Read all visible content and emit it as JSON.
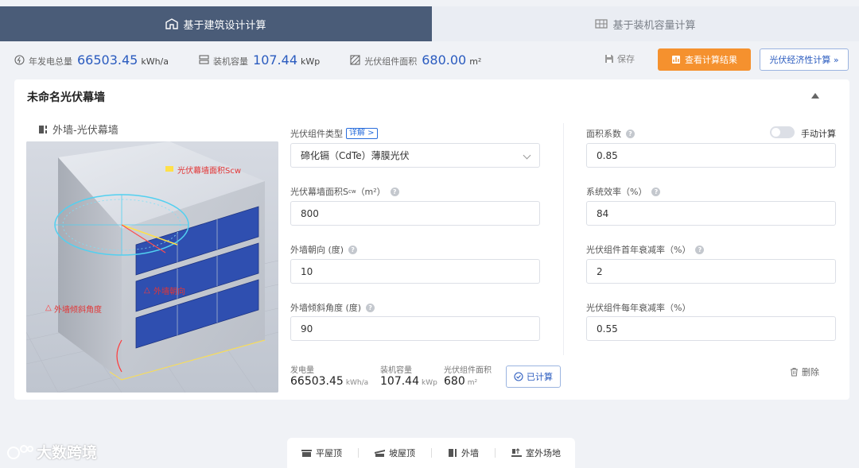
{
  "tabs": [
    {
      "label": "基于建筑设计计算",
      "icon": "building-icon",
      "active": true
    },
    {
      "label": "基于装机容量计算",
      "icon": "panel-grid-icon",
      "active": false
    }
  ],
  "summary": {
    "annual_generation": {
      "label": "年发电总量",
      "value": "66503.45",
      "unit": "kWh/a"
    },
    "capacity": {
      "label": "装机容量",
      "value": "107.44",
      "unit": "kWp"
    },
    "area": {
      "label": "光伏组件面积",
      "value": "680.00",
      "unit": "m²"
    }
  },
  "actions": {
    "save_label": "保存",
    "view_result_label": "查看计算结果",
    "economics_label": "光伏经济性计算 »"
  },
  "card": {
    "title": "未命名光伏幕墙",
    "section_label": "外墙-光伏幕墙",
    "illustration": {
      "area_label": "光伏幕墙面积Scw",
      "orientation_label": "外墙朝向",
      "tilt_label": "外墙倾斜角度"
    }
  },
  "form": {
    "module_type": {
      "label": "光伏组件类型",
      "detail_link": "详解 >",
      "value": "碲化镉（CdTe）薄膜光伏"
    },
    "curtain_area": {
      "label": "光伏幕墙面积S",
      "sub": "cw",
      "label_suffix": "（m²）",
      "value": "800"
    },
    "orientation": {
      "label": "外墙朝向 (度)",
      "value": "10"
    },
    "tilt": {
      "label": "外墙倾斜角度 (度)",
      "value": "90"
    },
    "area_factor": {
      "label": "面积系数",
      "value": "0.85"
    },
    "manual_calc_label": "手动计算",
    "system_efficiency": {
      "label": "系统效率（%）",
      "value": "84"
    },
    "first_year_decay": {
      "label": "光伏组件首年衰减率（%）",
      "value": "2"
    },
    "annual_decay": {
      "label": "光伏组件每年衰减率（%）",
      "value": "0.55"
    }
  },
  "results": {
    "generation": {
      "label": "发电量",
      "value": "66503.45",
      "unit": "kWh/a"
    },
    "capacity": {
      "label": "装机容量",
      "value": "107.44",
      "unit": "kWp"
    },
    "area": {
      "label": "光伏组件面积",
      "value": "680",
      "unit": "m²"
    },
    "calculated_label": "已计算",
    "delete_label": "删除"
  },
  "bottom_tabs": [
    {
      "label": "平屋顶",
      "icon": "flat-roof-icon"
    },
    {
      "label": "坡屋顶",
      "icon": "sloped-roof-icon"
    },
    {
      "label": "外墙",
      "icon": "wall-icon"
    },
    {
      "label": "室外场地",
      "icon": "outdoor-site-icon"
    }
  ],
  "watermark": "大数跨境",
  "colors": {
    "primary": "#2a5bbf",
    "active_tab": "#4a5c78",
    "accent_orange": "#f5912e",
    "panel_blue": "#2f4fb0"
  }
}
